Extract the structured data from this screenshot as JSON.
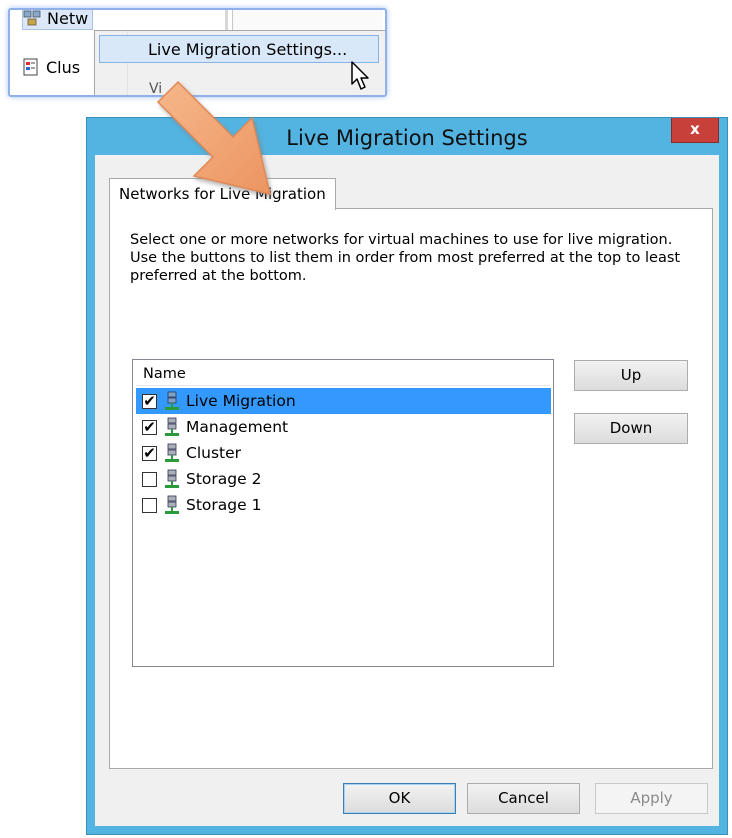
{
  "inset": {
    "tree_items": [
      {
        "label": "Netw"
      },
      {
        "label": "Clus"
      }
    ],
    "context_menu": {
      "highlighted_item": "Live Migration Settings...",
      "partial_item": "Vi"
    }
  },
  "dialog": {
    "title": "Live Migration Settings",
    "close_glyph": "x",
    "tab_label": "Networks for Live Migration",
    "description": "Select one or more networks for virtual machines to use for live migration. Use the buttons to list them in order from most preferred at the top to least preferred at the bottom.",
    "list": {
      "column_header": "Name",
      "rows": [
        {
          "label": "Live Migration",
          "checked": "✔",
          "selected": true
        },
        {
          "label": "Management",
          "checked": "✔",
          "selected": false
        },
        {
          "label": "Cluster",
          "checked": "✔",
          "selected": false
        },
        {
          "label": "Storage 2",
          "checked": "",
          "selected": false
        },
        {
          "label": "Storage 1",
          "checked": "",
          "selected": false
        }
      ]
    },
    "buttons": {
      "up": "Up",
      "down": "Down",
      "ok": "OK",
      "cancel": "Cancel",
      "apply": "Apply"
    }
  },
  "colors": {
    "frame": "#53b4e1",
    "close": "#c7413a",
    "selection": "#3399ff",
    "arrow": "#f0a070"
  }
}
